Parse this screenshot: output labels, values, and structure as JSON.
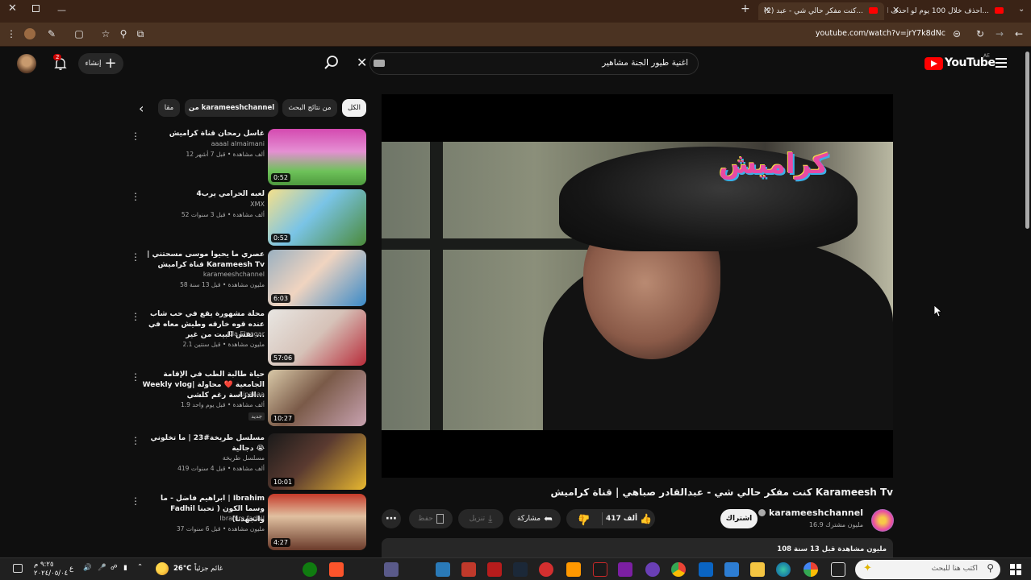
{
  "browser": {
    "tabs": [
      {
        "title": "احذف خلال 100 يوم لو احذف الف...",
        "active": false
      },
      {
        "title": "(2) كنت مفكر حالي شي - عبد...",
        "active": true
      }
    ],
    "url": "youtube.com/watch?v=jrY7k8dNc"
  },
  "header": {
    "logo_text": "YouTube",
    "logo_region": "AE",
    "search_value": "اغنية طيور الجنة مشاهير",
    "create_label": "إنشاء",
    "notification_count": "2"
  },
  "chips": [
    "الكل",
    "من نتائج البحث",
    "من karameeshchannel",
    "مقا"
  ],
  "video": {
    "overlay_logo": "كراميش",
    "title": "كنت مفكر حالي شي - عبدالقادر صباهي | قناة كراميش Karameesh Tv",
    "channel": "karameeshchannel",
    "subscribers": "16.9 مليون مشترك",
    "subscribe_label": "اشتراك",
    "likes": "417 ألف",
    "share_label": "مشاركة",
    "download_label": "تنزيل",
    "save_label": "حفظ",
    "description_meta": "108 مليون مشاهدة  قبل 13 سنة"
  },
  "sidebar": [
    {
      "title": "غاسل رمحان قناة كراميش",
      "channel": "aaaal almaimani",
      "meta": "12 ألف مشاهدة • قبل 7 أشهر",
      "duration": "0:52"
    },
    {
      "title": "لعبه الحرامي يرب4",
      "channel": "XMX",
      "meta": "52 ألف مشاهدة • قبل 3 سنوات",
      "duration": "0:52"
    },
    {
      "title": "عصري ما يحيوا موسى مسحتني | قناة كراميش Karameesh Tv",
      "channel": "karameeshchannel",
      "meta": "58 مليون مشاهدة • قبل 13 سنة",
      "duration": "6:03"
    },
    {
      "title": "محلة مشهورة يقع في حب شاب عنده قوه خارقه وطيش معاه في نفس البيت من غير ...",
      "channel": "Ola Elnagar",
      "meta": "2.1 مليون مشاهدة • قبل سنتين",
      "duration": "57:06"
    },
    {
      "title": "حياة طالبة الطب في الإقامة Weekly vlog| الجامعية ❤️ محاولة الدراسة رغم كلشي...",
      "channel": "Linaaaa",
      "meta": "1.9 ألف مشاهدة • قبل يوم واحد",
      "badge": "جديد",
      "duration": "10:27"
    },
    {
      "title": "مسلسل طريخة#23 | ما تخلوني دجالية 😭",
      "channel": "مسلسل طريخة",
      "meta": "419 ألف مشاهدة • قبل 4 سنوات",
      "duration": "10:01"
    },
    {
      "title": "ابراهيم فاضل - ما | Ibrahim Fadhil وسما الكون ( تحبنا وانجهدنا)",
      "channel": "Ibrahim fadhil",
      "meta": "37 مليون مشاهدة • قبل 6 سنوات",
      "duration": "4:27"
    }
  ],
  "taskbar": {
    "search_placeholder": "اكتب هنا للبحث",
    "weather_temp": "26°C",
    "weather_label": "غائم جزئياً",
    "time": "٩:٢٥ م",
    "date": "٢٠٢٤/٠٥/٠٤",
    "lang": "ع"
  }
}
